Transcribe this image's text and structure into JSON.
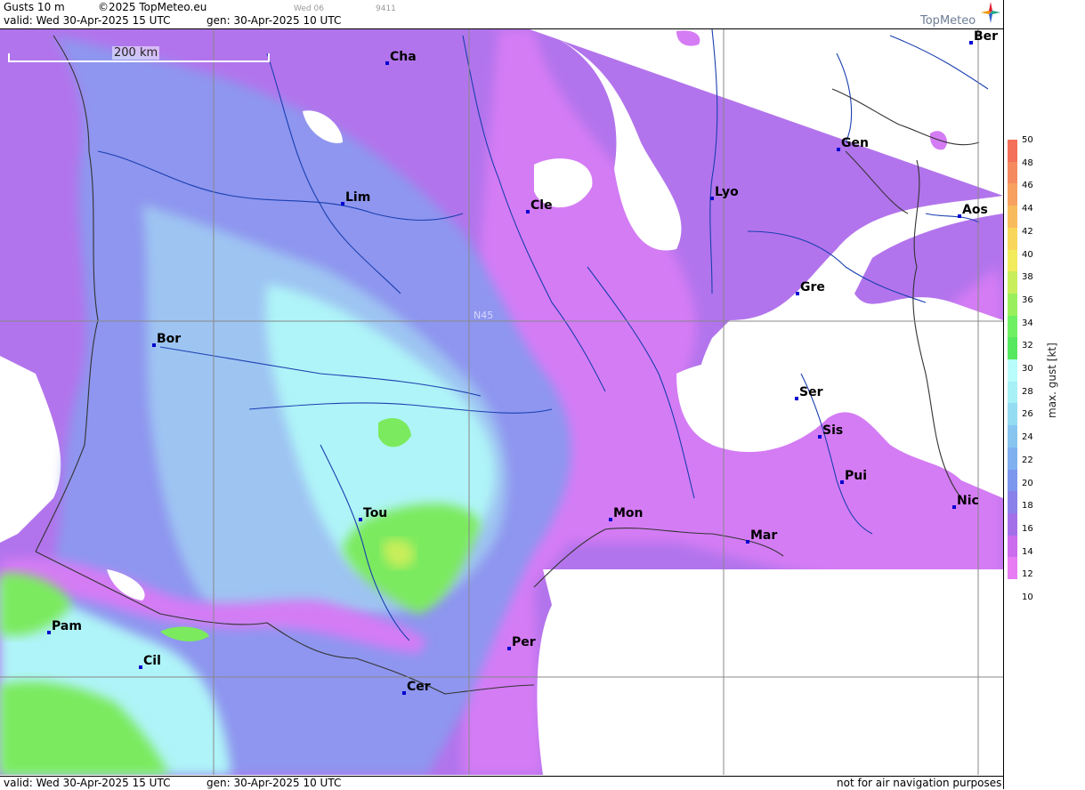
{
  "header": {
    "product": "Gusts 10 m",
    "copyright": "©2025 TopMeteo.eu",
    "tag": "Wed 06",
    "code": "9411",
    "valid": "valid:  Wed  30-Apr-2025  15 UTC",
    "gen": "gen: 30-Apr-2025 10 UTC"
  },
  "logo": {
    "text": "TopMeteo",
    "icon": "compass-star-icon"
  },
  "scale_bar": "200 km",
  "grid_label": "N45",
  "cities": [
    "Cha",
    "Lim",
    "Cle",
    "Lyo",
    "Gen",
    "Ber",
    "Aos",
    "Gre",
    "Bor",
    "Ser",
    "Sis",
    "Pui",
    "Nic",
    "Tou",
    "Mon",
    "Mar",
    "Pam",
    "Cil",
    "Per",
    "Cer"
  ],
  "legend": {
    "title": "max. gust  [kt]",
    "ticks": [
      "50",
      "48",
      "46",
      "44",
      "42",
      "40",
      "38",
      "36",
      "34",
      "32",
      "30",
      "28",
      "26",
      "24",
      "22",
      "20",
      "18",
      "16",
      "14",
      "12",
      "10"
    ],
    "colors": [
      "#f4705a",
      "#f58a60",
      "#f7a060",
      "#f8bb5c",
      "#f8d65a",
      "#f2ec5c",
      "#c8ee5a",
      "#9af05c",
      "#6ef063",
      "#55e860",
      "#b8fcfb",
      "#a6f0f6",
      "#94dcf2",
      "#88c6f0",
      "#80b0f0",
      "#7c98ee",
      "#8a82ea",
      "#a370ea",
      "#cc6cee",
      "#e87cf4"
    ]
  },
  "footer": {
    "valid": "valid:  Wed  30-Apr-2025  15 UTC",
    "gen": "gen: 30-Apr-2025 10 UTC",
    "notice": "not for air navigation purposes"
  }
}
